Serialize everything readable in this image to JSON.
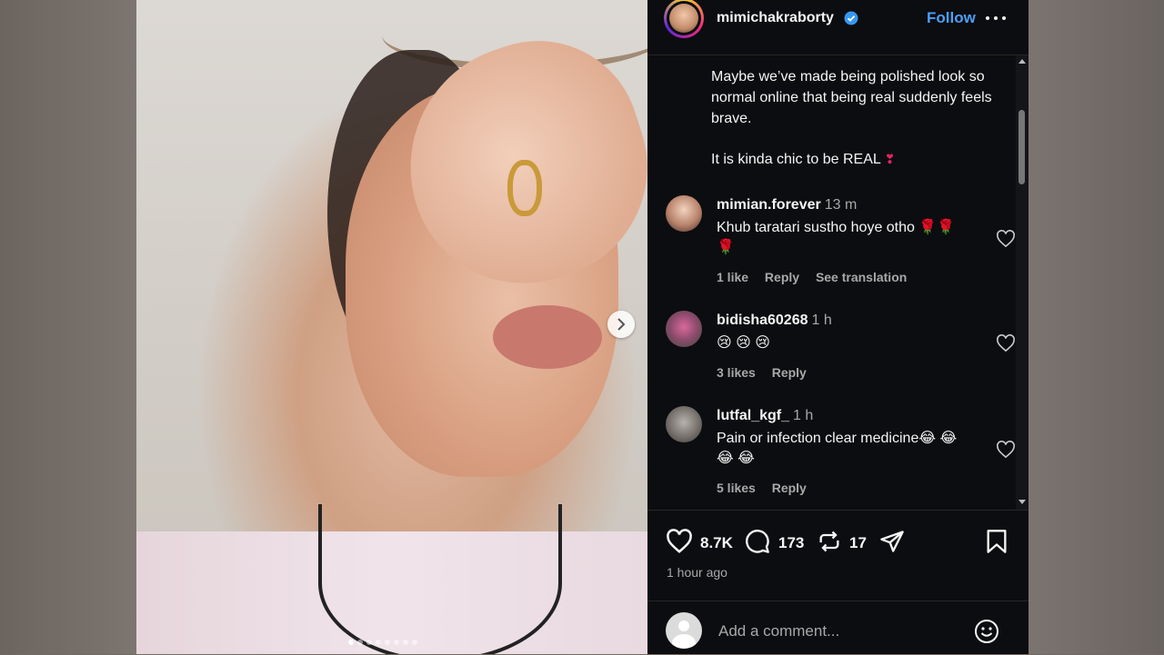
{
  "post": {
    "username": "mimichakraborty",
    "follow_label": "Follow",
    "caption_lines": [
      "Maybe we’ve made being polished look so normal online that being real suddenly feels brave.",
      "It is kinda chic to be REAL"
    ],
    "caption_emoji": "❣"
  },
  "comments": [
    {
      "username": "mimian.forever",
      "time": "13 m",
      "text": "Khub taratari sustho hoye otho 🌹🌹🌹",
      "likes": "1 like",
      "reply": "Reply",
      "translate": "See translation"
    },
    {
      "username": "bidisha60268",
      "time": "1 h",
      "text": "😢 😢 😢",
      "likes": "3 likes",
      "reply": "Reply"
    },
    {
      "username": "lutfal_kgf_",
      "time": "1 h",
      "text": "Pain or infection clear medicine😂 😂 😂 😂",
      "likes": "5 likes",
      "reply": "Reply"
    }
  ],
  "actions": {
    "like_count": "8.7K",
    "comment_count": "173",
    "repost_count": "17",
    "posted_time": "1 hour ago"
  },
  "add_comment": {
    "placeholder": "Add a comment..."
  },
  "carousel": {
    "total": 8,
    "active": 1
  },
  "icons": {
    "verified": "verified-badge-icon",
    "more": "more-options-icon",
    "like": "heart-icon",
    "comment": "comment-icon",
    "repost": "repost-icon",
    "share": "share-icon",
    "save": "bookmark-icon",
    "emoji": "emoji-icon",
    "next": "chevron-right-icon"
  },
  "colors": {
    "accent": "#4c9ff8",
    "panel_bg": "#0c0d10",
    "muted_text": "#a8a8a8"
  }
}
